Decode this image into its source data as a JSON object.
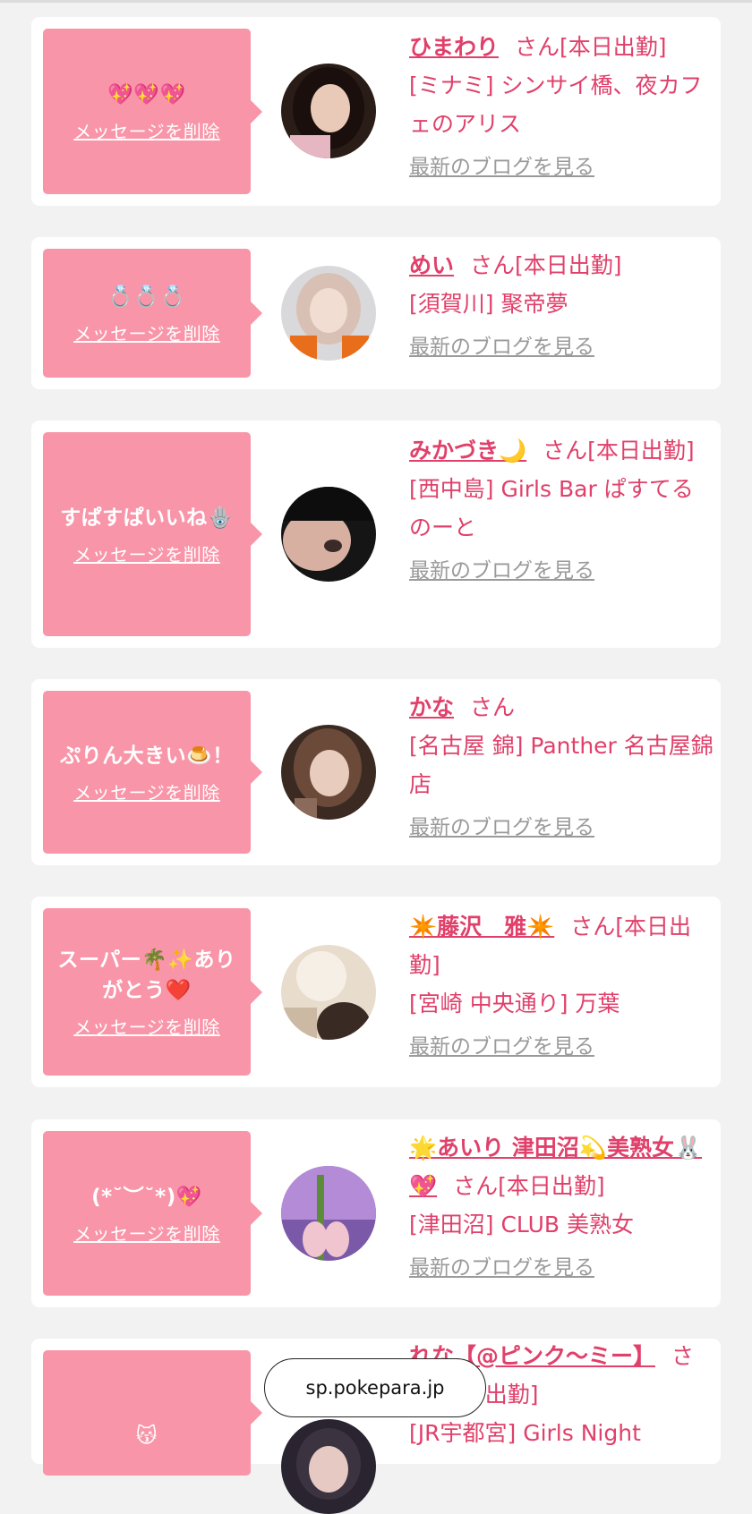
{
  "cards": [
    {
      "message": "💖💖💖",
      "delete_label": "メッセージを削除",
      "name": "ひまわり",
      "san": "さん",
      "status": "[本日出勤]",
      "shop": "[ミナミ] シンサイ橋、夜カフェのアリス",
      "blog_label": "最新のブログを見る",
      "avatar": {
        "bg": "#2a1d18",
        "hair": "#1a0f0c",
        "face": "#e9c9b8",
        "accent": "#e7b6c3"
      }
    },
    {
      "message": "💍💍💍",
      "delete_label": "メッセージを削除",
      "name": "めい",
      "san": "さん",
      "status": "[本日出勤]",
      "shop": "[須賀川] 聚帝夢",
      "blog_label": "最新のブログを見る",
      "avatar": {
        "bg": "#d9d9dc",
        "hair": "#d8c1b4",
        "face": "#f1ddd2",
        "accent": "#e86e1c"
      }
    },
    {
      "message": "すぱすぱいいね🪬",
      "delete_label": "メッセージを削除",
      "name": "みかづき🌙",
      "san": "さん",
      "status": "[本日出勤]",
      "shop": "[西中島] Girls Bar ぱすてるのーと",
      "blog_label": "最新のブログを見る",
      "avatar": {
        "bg": "#151515",
        "hair": "#0d0d0d",
        "face": "#d7b0a2",
        "accent": "#3a2b28"
      }
    },
    {
      "message": "ぷりん大きい🍮！",
      "delete_label": "メッセージを削除",
      "name": "かな",
      "san": "さん",
      "status": "",
      "shop": "[名古屋 錦] Panther 名古屋錦店",
      "blog_label": "最新のブログを見る",
      "avatar": {
        "bg": "#3b2a22",
        "hair": "#6b4a3a",
        "face": "#e8cdbf",
        "accent": "#8a6a5a"
      }
    },
    {
      "message": "スーパー🌴✨ありがとう❤️",
      "delete_label": "メッセージを削除",
      "name": "✴️藤沢　雅✴️",
      "san": "さん",
      "status": "[本日出勤]",
      "shop": "[宮崎 中央通り] 万葉",
      "blog_label": "最新のブログを見る",
      "avatar": {
        "bg": "#e8dccd",
        "hair": "#3a2a24",
        "face": "#f6efe6",
        "accent": "#cbb9a4"
      }
    },
    {
      "message": "(*˘︶˘*)💖",
      "delete_label": "メッセージを削除",
      "name": "🌟あいり 津田沼💫美熟女🐰💖",
      "san": "さん",
      "status": "[本日出勤]",
      "shop": "[津田沼] CLUB 美熟女",
      "blog_label": "最新のブログを見る",
      "avatar": {
        "bg": "#7a5aa8",
        "hair": "#b48bd6",
        "face": "#f0c5cf",
        "accent": "#5b8c3a"
      }
    },
    {
      "message": "😽",
      "delete_label": "",
      "name": "れな【@ピンク〜ミー】",
      "san": "さん",
      "status": "[本日出勤]",
      "shop": "[JR宇都宮] Girls Night",
      "blog_label": "",
      "avatar": {
        "bg": "#2a2430",
        "hair": "#3b3340",
        "face": "#e6c9c3",
        "accent": "#6b5a70"
      }
    }
  ],
  "url_bar": {
    "text": "sp.pokepara.jp"
  }
}
